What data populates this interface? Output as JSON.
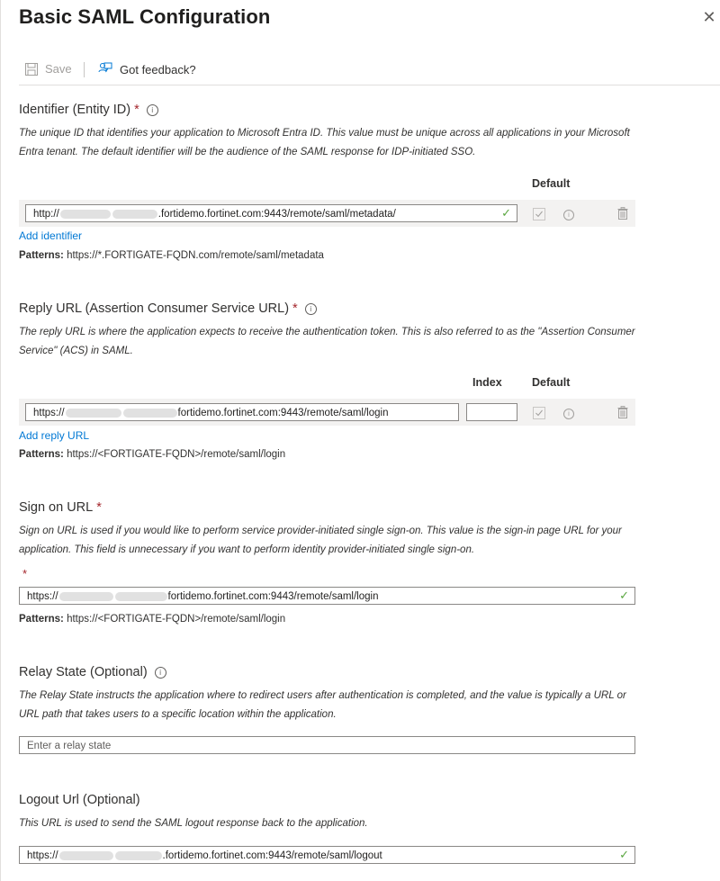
{
  "title": "Basic SAML Configuration",
  "close_glyph": "✕",
  "toolbar": {
    "save_label": "Save",
    "feedback_label": "Got feedback?"
  },
  "identifier": {
    "title": "Identifier (Entity ID)",
    "required": "*",
    "description": "The unique ID that identifies your application to Microsoft Entra ID. This value must be unique across all applications in your Microsoft Entra tenant. The default identifier will be the audience of the SAML response for IDP-initiated SSO.",
    "default_header": "Default",
    "value_prefix": "http://",
    "value_suffix": ".fortidemo.fortinet.com:9443/remote/saml/metadata/",
    "add_link": "Add identifier",
    "patterns_label": "Patterns:",
    "patterns_value": "https://*.FORTIGATE-FQDN.com/remote/saml/metadata"
  },
  "reply": {
    "title": "Reply URL (Assertion Consumer Service URL)",
    "required": "*",
    "description": "The reply URL is where the application expects to receive the authentication token. This is also referred to as the \"Assertion Consumer Service\" (ACS) in SAML.",
    "index_header": "Index",
    "default_header": "Default",
    "value_prefix": "https://",
    "value_suffix": "fortidemo.fortinet.com:9443/remote/saml/login",
    "index_value": "",
    "add_link": "Add reply URL",
    "patterns_label": "Patterns:",
    "patterns_value": "https://<FORTIGATE-FQDN>/remote/saml/login"
  },
  "signon": {
    "title": "Sign on URL",
    "required": "*",
    "description": "Sign on URL is used if you would like to perform service provider-initiated single sign-on. This value is the sign-in page URL for your application. This field is unnecessary if you want to perform identity provider-initiated single sign-on.",
    "field_required": "*",
    "value_prefix": "https://",
    "value_suffix": "fortidemo.fortinet.com:9443/remote/saml/login",
    "patterns_label": "Patterns:",
    "patterns_value": "https://<FORTIGATE-FQDN>/remote/saml/login"
  },
  "relay": {
    "title": "Relay State (Optional)",
    "description": "The Relay State instructs the application where to redirect users after authentication is completed, and the value is typically a URL or URL path that takes users to a specific location within the application.",
    "placeholder": "Enter a relay state"
  },
  "logout": {
    "title": "Logout Url (Optional)",
    "description": "This URL is used to send the SAML logout response back to the application.",
    "value_prefix": "https://",
    "value_suffix": ".fortidemo.fortinet.com:9443/remote/saml/logout"
  },
  "icons": {
    "check": "✓",
    "info": "i"
  },
  "colors": {
    "accent": "#0078d4",
    "required": "#a4262c",
    "valid": "#5aa640"
  }
}
